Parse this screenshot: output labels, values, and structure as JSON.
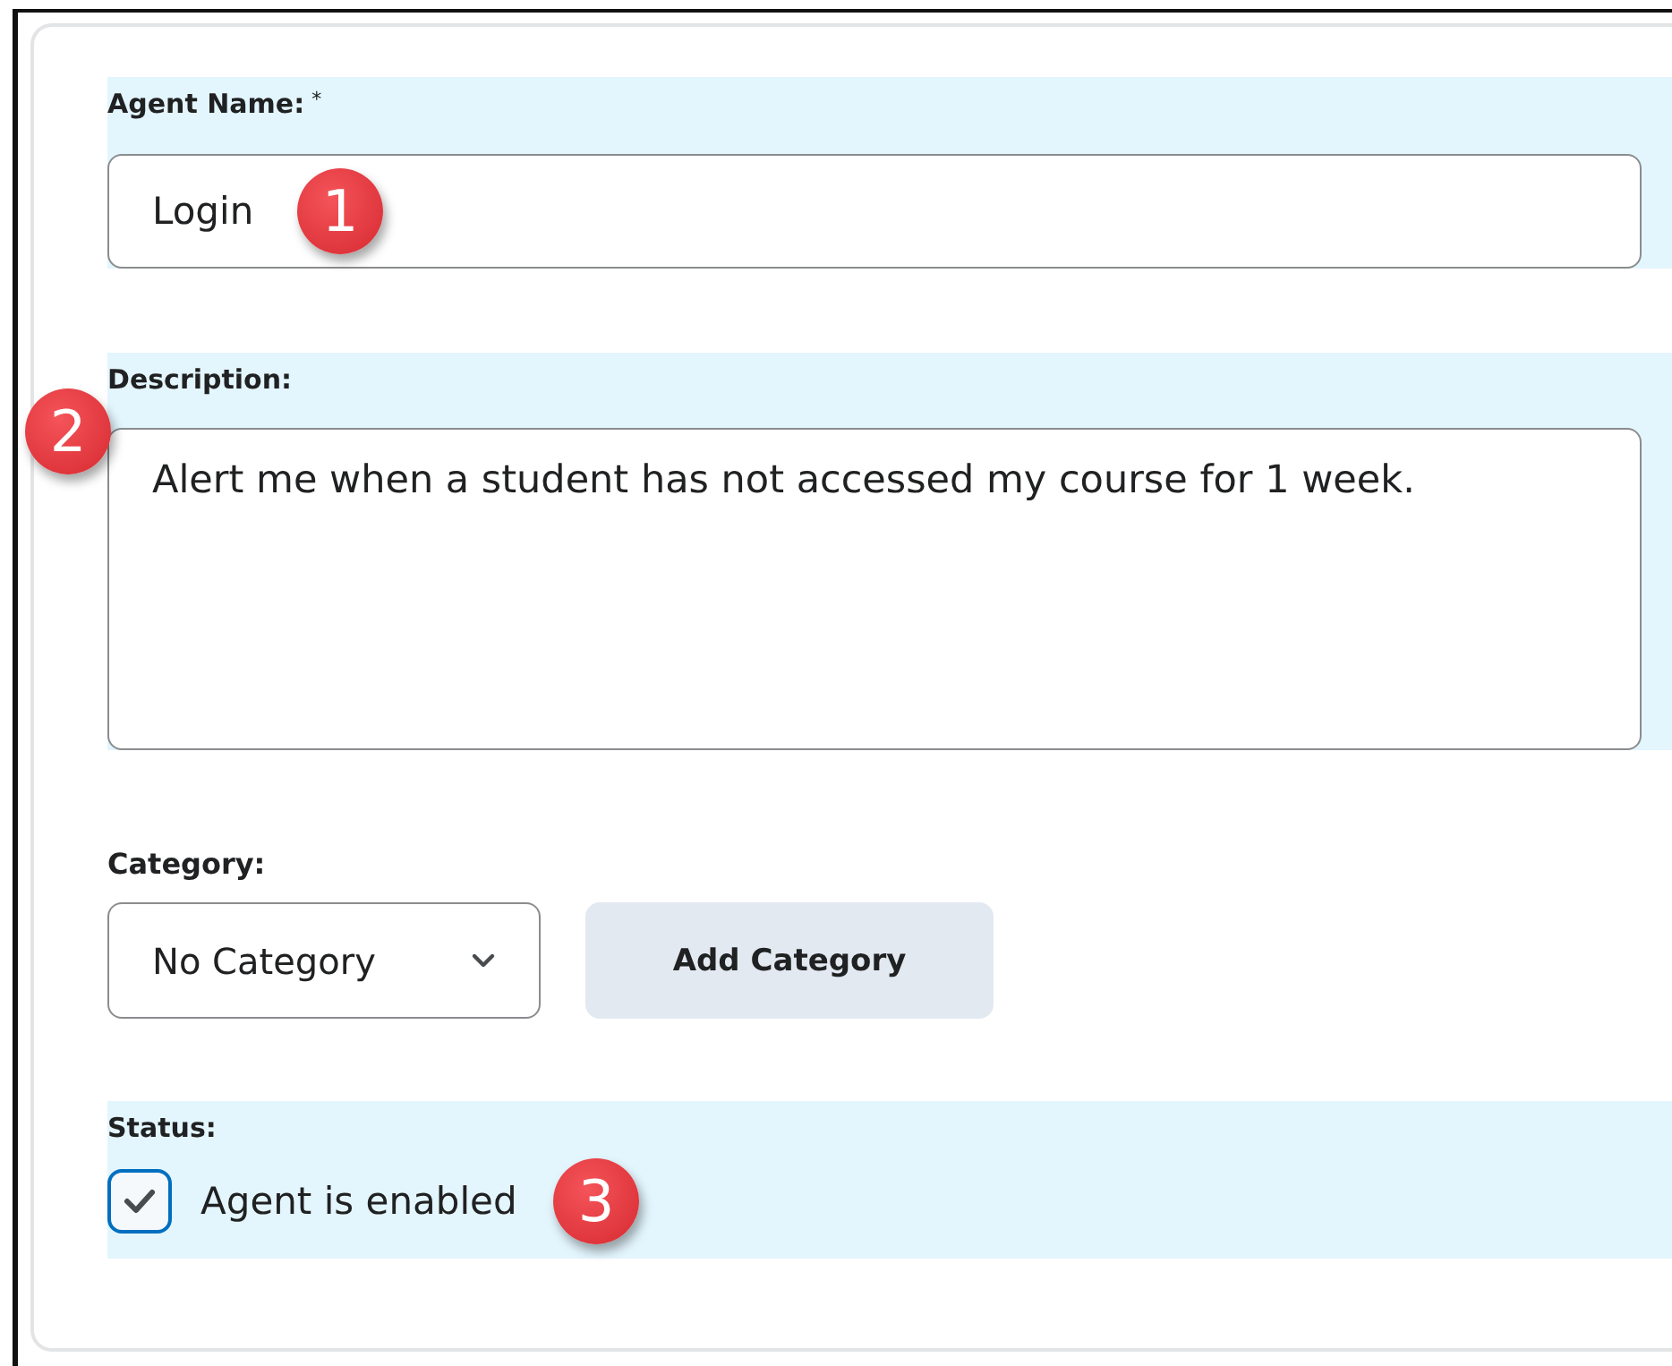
{
  "agent_name": {
    "label": "Agent Name:",
    "required_mark": "*",
    "value": "Login"
  },
  "description": {
    "label": "Description:",
    "value": "Alert me when a student has not accessed my course for 1 week."
  },
  "category": {
    "label": "Category:",
    "value": "No Category",
    "button": "Add Category"
  },
  "status": {
    "label": "Status:",
    "checkbox": {
      "label": "Agent is enabled",
      "checked": true
    }
  },
  "callouts": [
    {
      "number": "1"
    },
    {
      "number": "2"
    },
    {
      "number": "3"
    }
  ]
}
